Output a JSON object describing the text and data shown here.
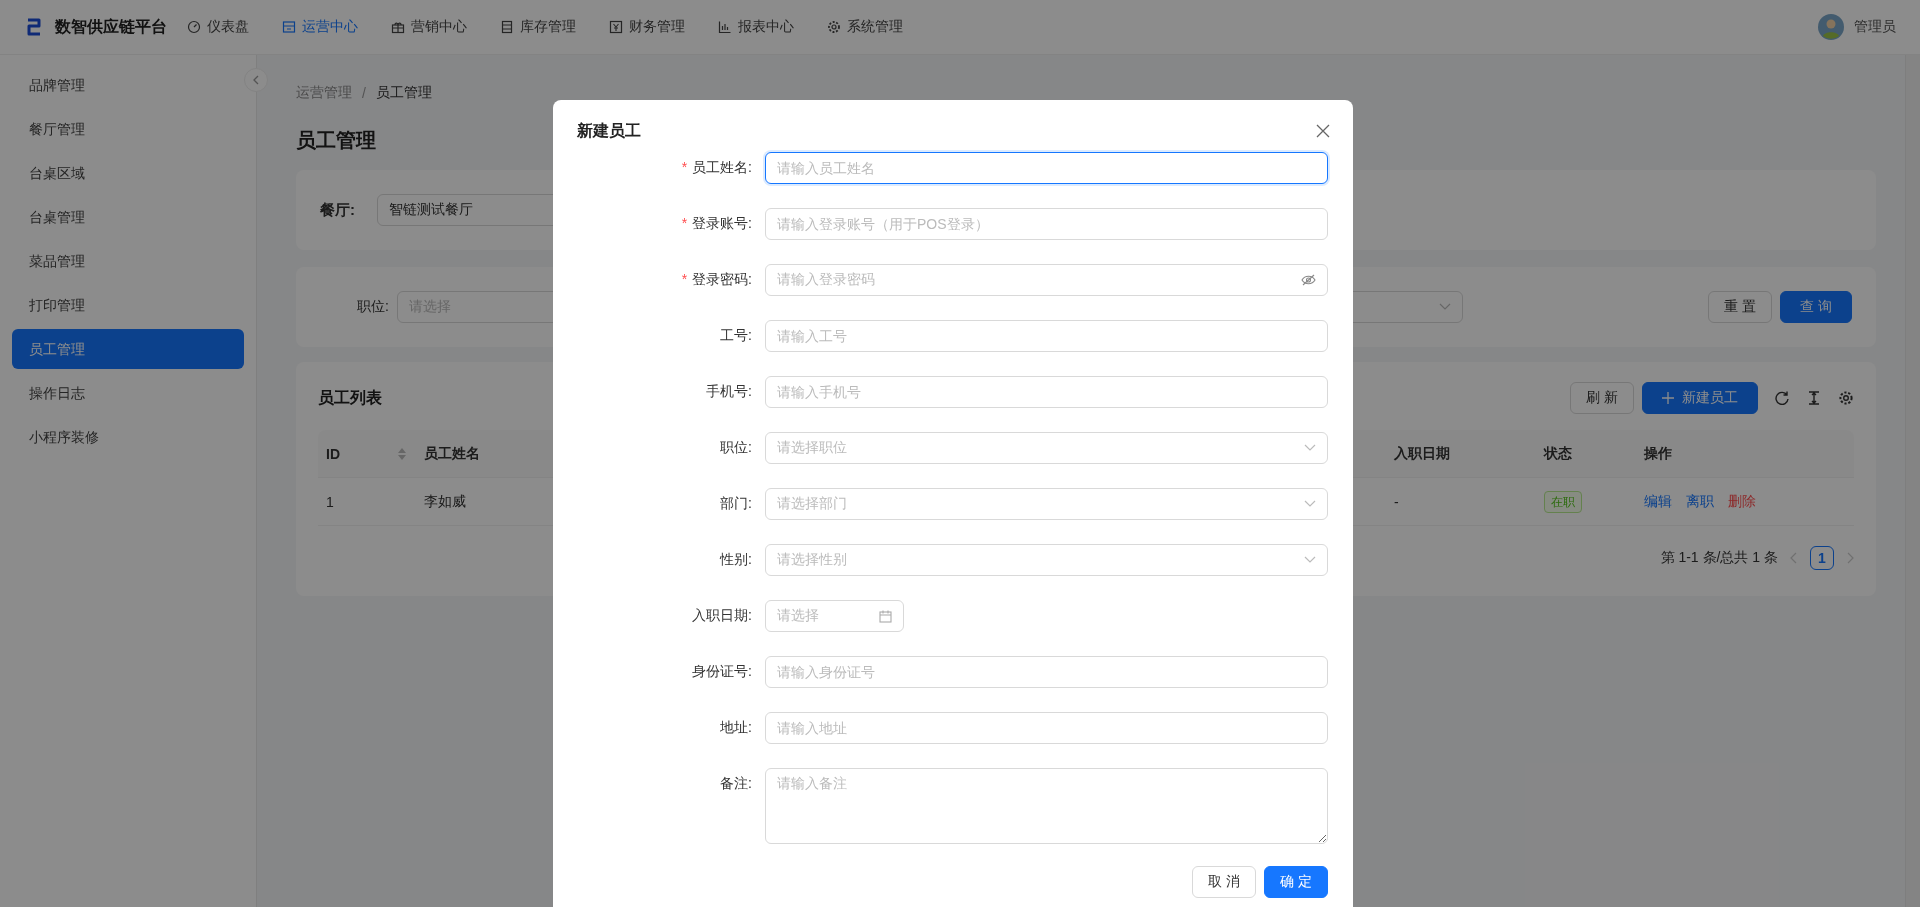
{
  "header": {
    "title": "数智供应链平台",
    "user": "管理员",
    "nav": [
      {
        "label": "仪表盘",
        "selected": false
      },
      {
        "label": "运营中心",
        "selected": true
      },
      {
        "label": "营销中心",
        "selected": false
      },
      {
        "label": "库存管理",
        "selected": false
      },
      {
        "label": "财务管理",
        "selected": false
      },
      {
        "label": "报表中心",
        "selected": false
      },
      {
        "label": "系统管理",
        "selected": false
      }
    ]
  },
  "sidebar": {
    "items": [
      {
        "label": "品牌管理",
        "selected": false
      },
      {
        "label": "餐厅管理",
        "selected": false
      },
      {
        "label": "台桌区域",
        "selected": false
      },
      {
        "label": "台桌管理",
        "selected": false
      },
      {
        "label": "菜品管理",
        "selected": false
      },
      {
        "label": "打印管理",
        "selected": false
      },
      {
        "label": "员工管理",
        "selected": true
      },
      {
        "label": "操作日志",
        "selected": false
      },
      {
        "label": "小程序装修",
        "selected": false
      }
    ]
  },
  "breadcrumb": {
    "items": [
      "运营管理",
      "员工管理"
    ],
    "separator": "/"
  },
  "page_title": "员工管理",
  "restaurant_filter": {
    "label": "餐厅:",
    "value": "智链测试餐厅"
  },
  "search": {
    "label": "职位:",
    "placeholder": "请选择",
    "buttons": [
      {
        "label": "重 置",
        "kind": "default"
      },
      {
        "label": "查 询",
        "kind": "primary"
      }
    ]
  },
  "list": {
    "title": "员工列表",
    "buttons": [
      {
        "label": "刷 新",
        "kind": "default"
      },
      {
        "label": "新建员工",
        "kind": "primary"
      }
    ],
    "columns": [
      {
        "label": "ID",
        "sortable": true
      },
      {
        "label": "员工姓名",
        "sortable": false
      },
      {
        "label": "入职日期",
        "sortable": false
      },
      {
        "label": "状态",
        "sortable": false
      },
      {
        "label": "操作",
        "sortable": false
      }
    ],
    "rows": [
      {
        "id": "1",
        "name": "李如威",
        "hire_date": "-",
        "status": {
          "label": "在职",
          "kind": "active"
        },
        "actions": [
          {
            "label": "编辑",
            "kind": "link"
          },
          {
            "label": "离职",
            "kind": "link"
          },
          {
            "label": "删除",
            "kind": "danger"
          }
        ]
      }
    ],
    "pagination": {
      "summary": "第 1-1 条/总共 1 条",
      "pages": [
        {
          "label": "1",
          "selected": true
        }
      ]
    }
  },
  "modal": {
    "title": "新建员工",
    "required_mark": "*",
    "fields": [
      {
        "label": "员工姓名:",
        "required": true,
        "kind": "input",
        "placeholder": "请输入员工姓名",
        "focused": true
      },
      {
        "label": "登录账号:",
        "required": true,
        "kind": "input",
        "placeholder": "请输入登录账号（用于POS登录）",
        "focused": false
      },
      {
        "label": "登录密码:",
        "required": true,
        "kind": "password",
        "placeholder": "请输入登录密码",
        "focused": false
      },
      {
        "label": "工号:",
        "required": false,
        "kind": "input",
        "placeholder": "请输入工号",
        "focused": false
      },
      {
        "label": "手机号:",
        "required": false,
        "kind": "input",
        "placeholder": "请输入手机号",
        "focused": false
      },
      {
        "label": "职位:",
        "required": false,
        "kind": "select",
        "placeholder": "请选择职位",
        "focused": false
      },
      {
        "label": "部门:",
        "required": false,
        "kind": "select",
        "placeholder": "请选择部门",
        "focused": false
      },
      {
        "label": "性别:",
        "required": false,
        "kind": "select",
        "placeholder": "请选择性别",
        "focused": false
      },
      {
        "label": "入职日期:",
        "required": false,
        "kind": "date",
        "placeholder": "请选择",
        "focused": false
      },
      {
        "label": "身份证号:",
        "required": false,
        "kind": "input",
        "placeholder": "请输入身份证号",
        "focused": false
      },
      {
        "label": "地址:",
        "required": false,
        "kind": "input",
        "placeholder": "请输入地址",
        "focused": false
      },
      {
        "label": "备注:",
        "required": false,
        "kind": "textarea",
        "placeholder": "请输入备注",
        "focused": false
      }
    ],
    "buttons": [
      {
        "label": "取 消",
        "kind": "default"
      },
      {
        "label": "确 定",
        "kind": "primary"
      }
    ]
  }
}
